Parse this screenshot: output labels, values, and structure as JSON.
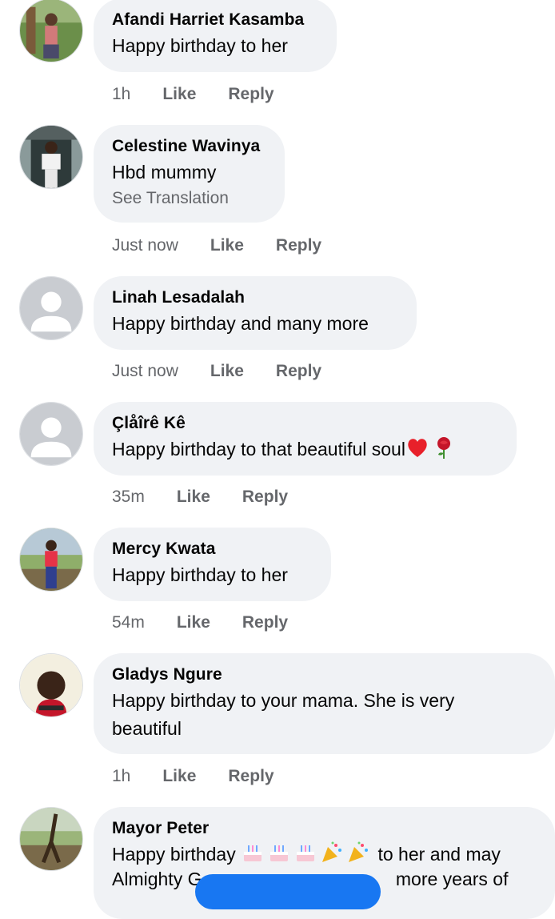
{
  "comments": [
    {
      "name": "Afandi Harriet Kasamba",
      "text": "Happy birthday to her",
      "time": "1h",
      "like": "Like",
      "reply": "Reply",
      "avatar": "photo-person-outdoor"
    },
    {
      "name": "Celestine Wavinya",
      "text": "Hbd mummy",
      "translation": "See Translation",
      "time": "Just now",
      "like": "Like",
      "reply": "Reply",
      "avatar": "photo-person-doorway"
    },
    {
      "name": "Linah Lesadalah",
      "text": "Happy birthday and many more",
      "time": "Just now",
      "like": "Like",
      "reply": "Reply",
      "avatar": "default-avatar"
    },
    {
      "name": "Çlåîrê Kê",
      "text": "Happy birthday to that beautiful soul",
      "emojis": [
        "red-heart-emoji",
        "rose-emoji"
      ],
      "time": "35m",
      "like": "Like",
      "reply": "Reply",
      "avatar": "default-avatar"
    },
    {
      "name": "Mercy Kwata",
      "text": "Happy birthday to her",
      "time": "54m",
      "like": "Like",
      "reply": "Reply",
      "avatar": "photo-person-red-top"
    },
    {
      "name": "Gladys Ngure",
      "text_line1": "Happy birthday to your mama. She is very",
      "text_line2": "beautiful",
      "time": "1h",
      "like": "Like",
      "reply": "Reply",
      "avatar": "photo-selfie"
    },
    {
      "name": "Mayor Peter",
      "text_start": "Happy birthday",
      "text_end": " to her and may",
      "text_line2_start": "Almighty G",
      "text_line2_end": " more years of",
      "emojis": [
        "birthday-cake-emoji",
        "birthday-cake-emoji",
        "birthday-cake-emoji",
        "party-popper-emoji",
        "party-popper-emoji"
      ],
      "avatar": "photo-person-field"
    }
  ],
  "colors": {
    "bubble": "#f0f2f5",
    "secondary_text": "#65676b",
    "accent": "#1877f2"
  }
}
